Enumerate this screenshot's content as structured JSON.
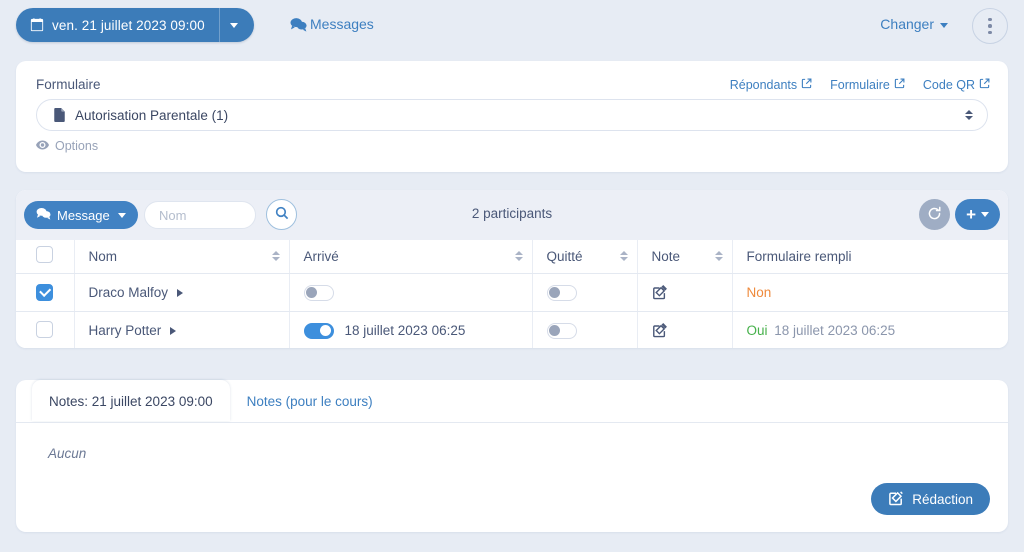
{
  "topbar": {
    "date_pill": {
      "label": "ven. 21 juillet 2023 09:00",
      "icon": "calendar-check-icon"
    },
    "messages": {
      "label": "Messages",
      "icon": "comments-icon"
    },
    "changer": {
      "label": "Changer"
    },
    "kebab": {
      "icon": "ellipsis-vertical-icon"
    }
  },
  "form_card": {
    "title": "Formulaire",
    "links": [
      {
        "label": "Répondants",
        "icon": "external-link-icon"
      },
      {
        "label": "Formulaire",
        "icon": "external-link-icon"
      },
      {
        "label": "Code QR",
        "icon": "external-link-icon"
      }
    ],
    "select": {
      "value": "Autorisation Parentale (1)",
      "icon": "file-icon"
    },
    "options": {
      "label": "Options",
      "icon": "eye-icon"
    }
  },
  "toolbar": {
    "message_button": {
      "label": "Message",
      "icon": "comments-icon"
    },
    "name_filter": {
      "value": "",
      "placeholder": "Nom"
    },
    "search_button": {
      "icon": "search-icon"
    },
    "participants_count": "2 participants",
    "refresh_button": {
      "icon": "refresh-icon"
    },
    "add_button": {
      "icon": "plus-icon"
    }
  },
  "table": {
    "columns": [
      {
        "key": "check",
        "label": "",
        "sortable": false
      },
      {
        "key": "nom",
        "label": "Nom",
        "sortable": true
      },
      {
        "key": "arrive",
        "label": "Arrivé",
        "sortable": true
      },
      {
        "key": "quitte",
        "label": "Quitté",
        "sortable": true
      },
      {
        "key": "note",
        "label": "Note",
        "sortable": true
      },
      {
        "key": "formulaire",
        "label": "Formulaire rempli",
        "sortable": false
      }
    ],
    "rows": [
      {
        "selected": true,
        "name": "Draco Malfoy",
        "arrived_on": false,
        "arrived_time": "",
        "left_on": false,
        "note_icon": "edit-note-icon",
        "form_status": "Non",
        "form_status_color": "#ef8a3c",
        "form_time": ""
      },
      {
        "selected": false,
        "name": "Harry Potter",
        "arrived_on": true,
        "arrived_time": "18 juillet 2023 06:25",
        "left_on": false,
        "note_icon": "edit-note-icon",
        "form_status": "Oui",
        "form_status_color": "#46b14b",
        "form_time": "18 juillet 2023 06:25"
      }
    ]
  },
  "notes_card": {
    "tabs": [
      {
        "label": "Notes: 21 juillet 2023 09:00",
        "active": true
      },
      {
        "label": "Notes (pour le cours)",
        "active": false
      }
    ],
    "body": "Aucun",
    "redaction_button": {
      "label": "Rédaction",
      "icon": "edit-note-icon"
    }
  },
  "colors": {
    "background": "#e7ecf4",
    "card": "#ffffff",
    "primary": "#3c7cb9",
    "accent_blue": "#3d8fdd",
    "link": "#3d7fc0",
    "text": "#4a5878",
    "muted": "#97a2b8",
    "toolbar_band": "#eceff6",
    "status_no": "#ef8a3c",
    "status_yes": "#46b14b"
  }
}
